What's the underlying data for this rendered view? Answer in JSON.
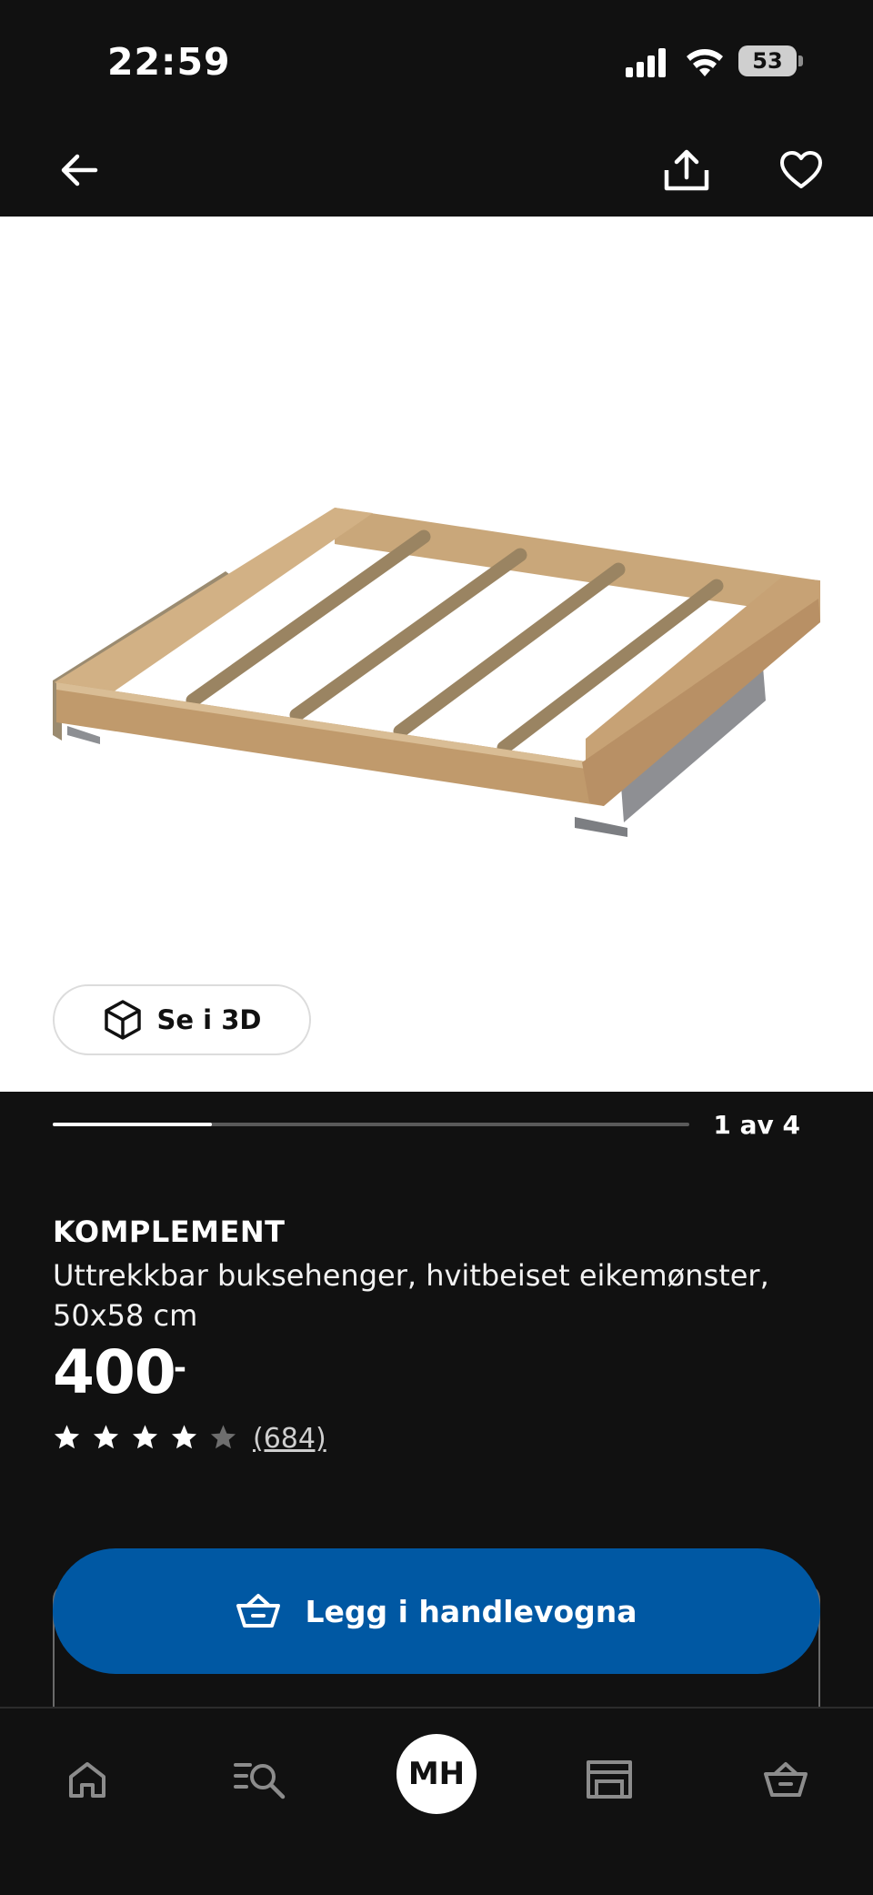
{
  "status": {
    "time": "22:59",
    "battery": "53"
  },
  "gallery": {
    "see_3d_label": "Se i 3D",
    "counter": "1 av 4",
    "progress": 0.25
  },
  "product": {
    "brand": "KOMPLEMENT",
    "description": "Uttrekkbar buksehenger, hvitbeiset eikemønster, 50x58 cm",
    "price": "400",
    "price_suffix": ",-",
    "rating": 4,
    "rating_max": 5,
    "reviews": "(684)"
  },
  "actions": {
    "add_to_cart": "Legg i handlevogna"
  },
  "tabbar": {
    "avatar_initials": "MH"
  },
  "colors": {
    "background": "#111111",
    "accent": "#0058a3"
  },
  "icons": [
    "back-arrow-icon",
    "share-icon",
    "heart-icon",
    "cube-3d-icon",
    "star-icon",
    "basket-icon",
    "home-icon",
    "search-list-icon",
    "store-icon"
  ]
}
